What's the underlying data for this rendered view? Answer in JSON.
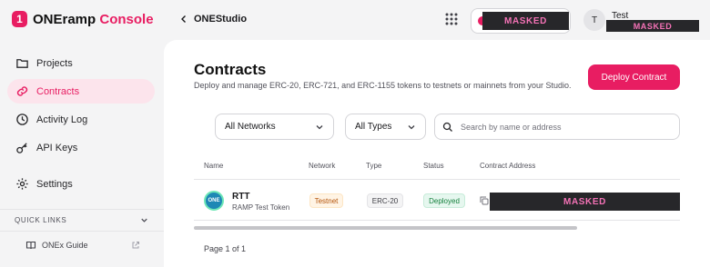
{
  "brand": {
    "logo_glyph": "1",
    "name": "ONEramp",
    "accent": "Console",
    "accent_color": "#e81d62"
  },
  "sidebar": {
    "items": [
      {
        "label": "Projects",
        "icon": "folder-icon",
        "active": false
      },
      {
        "label": "Contracts",
        "icon": "link-icon",
        "active": true
      },
      {
        "label": "Activity Log",
        "icon": "clock-icon",
        "active": false
      },
      {
        "label": "API Keys",
        "icon": "key-icon",
        "active": false
      },
      {
        "label": "Settings",
        "icon": "gear-icon",
        "active": false
      }
    ],
    "quick_links_label": "QUICK LINKS",
    "quick_links": [
      {
        "label": "ONEx Guide",
        "icon": "book-icon"
      }
    ]
  },
  "topbar": {
    "breadcrumb": "ONEStudio",
    "wallet_masked": "MASKED",
    "avatar_initial": "T",
    "user_name": "Test",
    "user_masked": "MASKED"
  },
  "page": {
    "title": "Contracts",
    "subtitle": "Deploy and manage ERC-20, ERC-721, and ERC-1155 tokens to testnets or mainnets from your Studio.",
    "deploy_label": "Deploy Contract"
  },
  "filters": {
    "network": "All Networks",
    "type": "All Types",
    "search_placeholder": "Search by name or address"
  },
  "table": {
    "headers": [
      "Name",
      "Network",
      "Type",
      "Status",
      "Contract Address"
    ],
    "rows": [
      {
        "logo_text": "ONE",
        "name": "RTT",
        "full_name": "RAMP Test Token",
        "network": "Testnet",
        "type": "ERC-20",
        "status": "Deployed",
        "address_masked": "MASKED"
      }
    ]
  },
  "pagination": {
    "label": "Page 1 of 1"
  }
}
